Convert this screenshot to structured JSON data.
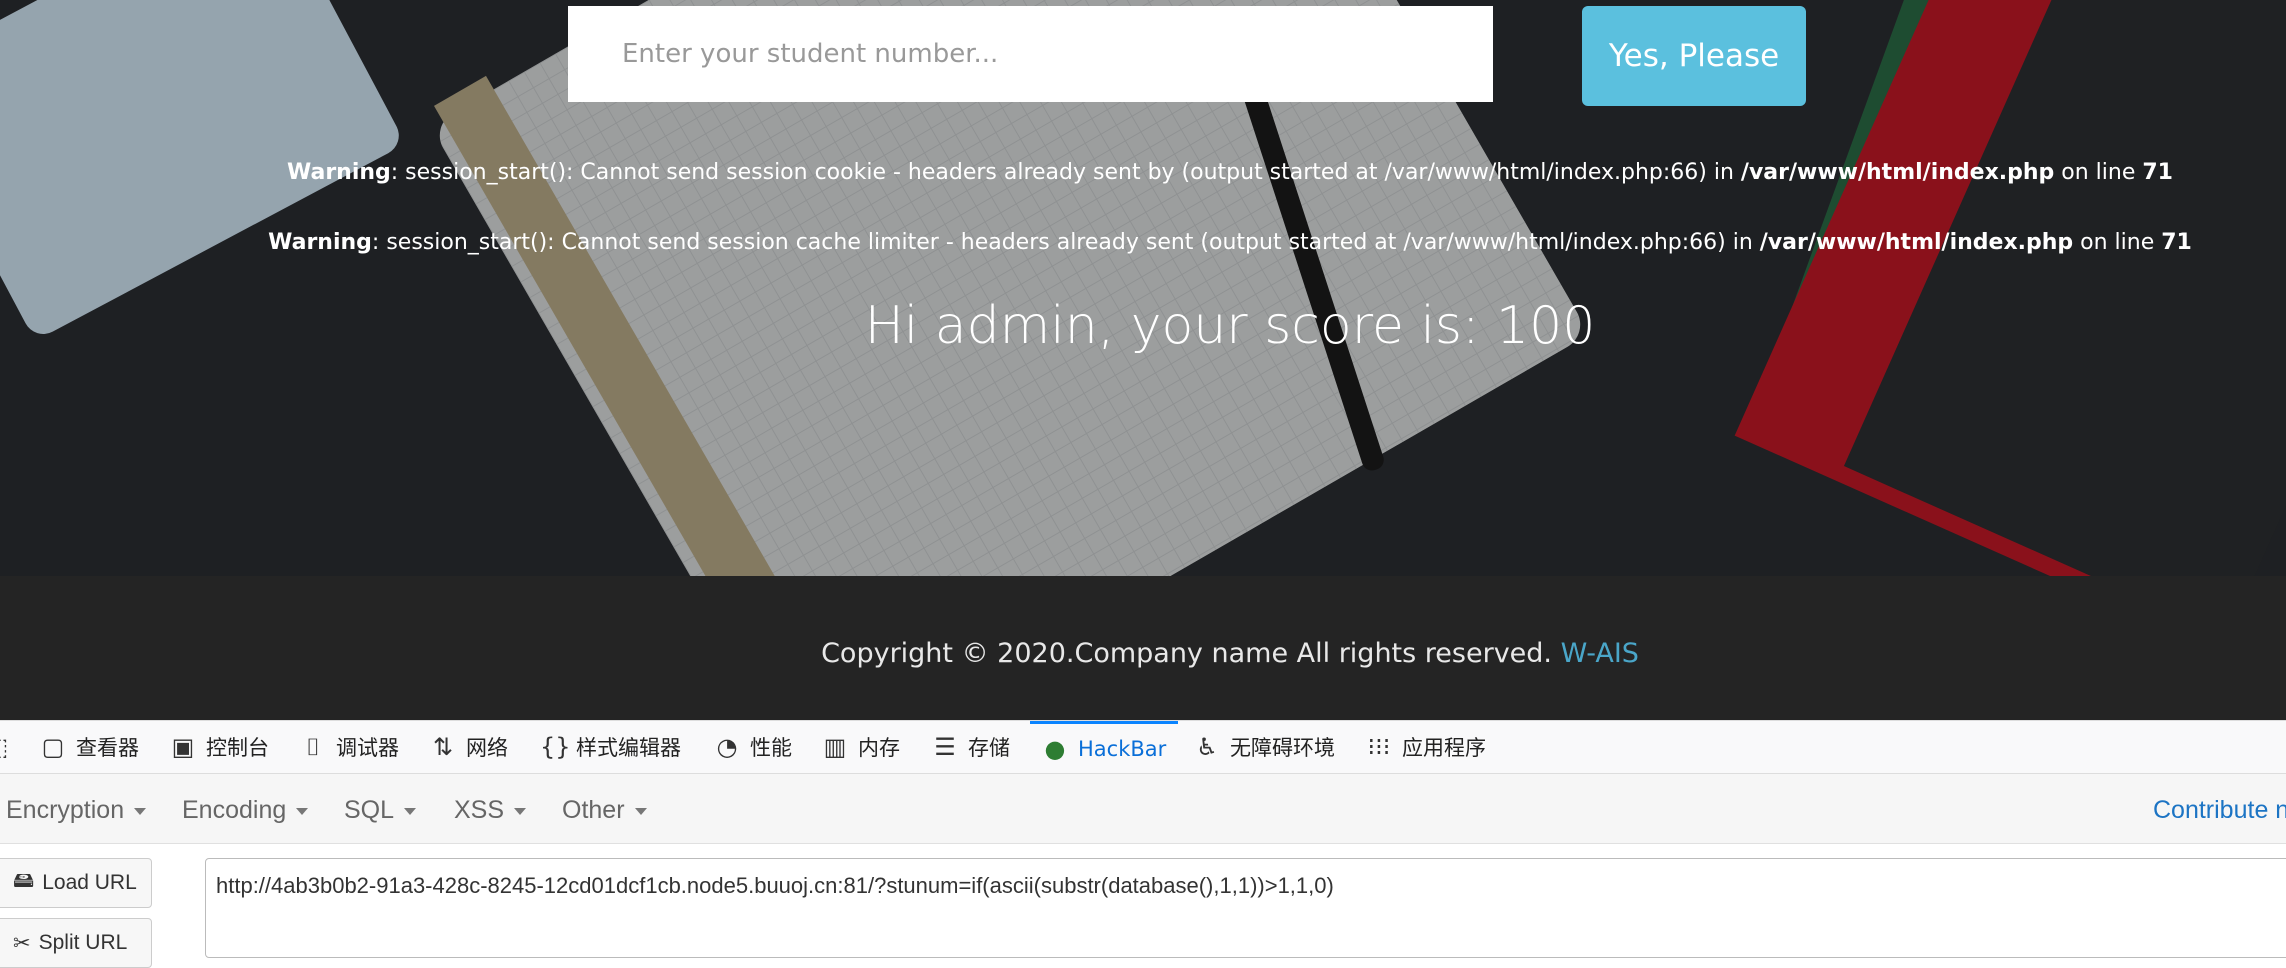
{
  "form": {
    "input_placeholder": "Enter your student number...",
    "submit_label": "Yes, Please"
  },
  "warnings": [
    {
      "label": "Warning",
      "message": ": session_start(): Cannot send session cookie - headers already sent by (output started at /var/www/html/index.php:66) in ",
      "file": "/var/www/html/index.php",
      "on_line": " on line ",
      "line": "71"
    },
    {
      "label": "Warning",
      "message": ": session_start(): Cannot send session cache limiter - headers already sent (output started at /var/www/html/index.php:66) in ",
      "file": "/var/www/html/index.php",
      "on_line": " on line ",
      "line": "71"
    }
  ],
  "score_text": "Hi admin, your score is: 100",
  "footer": {
    "copyright": "Copyright © 2020.Company name All rights reserved. ",
    "link": "W-AIS"
  },
  "devtools": {
    "tabs": [
      {
        "label": "查看器",
        "icon": "inspector-icon"
      },
      {
        "label": "控制台",
        "icon": "console-icon"
      },
      {
        "label": "调试器",
        "icon": "debugger-icon"
      },
      {
        "label": "网络",
        "icon": "network-icon"
      },
      {
        "label": "样式编辑器",
        "icon": "style-editor-icon"
      },
      {
        "label": "性能",
        "icon": "performance-icon"
      },
      {
        "label": "内存",
        "icon": "memory-icon"
      },
      {
        "label": "存储",
        "icon": "storage-icon"
      },
      {
        "label": "HackBar",
        "icon": "hackbar-icon",
        "active": true
      },
      {
        "label": "无障碍环境",
        "icon": "accessibility-icon"
      },
      {
        "label": "应用程序",
        "icon": "application-icon"
      }
    ]
  },
  "hackbar": {
    "menu": [
      "Encryption",
      "Encoding",
      "SQL",
      "XSS",
      "Other"
    ],
    "contribute": "Contribute n",
    "load_url": "Load URL",
    "split_url": "Split URL",
    "url": "http://4ab3b0b2-91a3-428c-8245-12cd01dcf1cb.node5.buuoj.cn:81/?stunum=if(ascii(substr(database(),1,1))>1,1,0)"
  },
  "colors": {
    "button": "#5bc0de",
    "footer_bg": "#242424",
    "link": "#4aa6c9",
    "active_tab": "#0a84ff"
  }
}
